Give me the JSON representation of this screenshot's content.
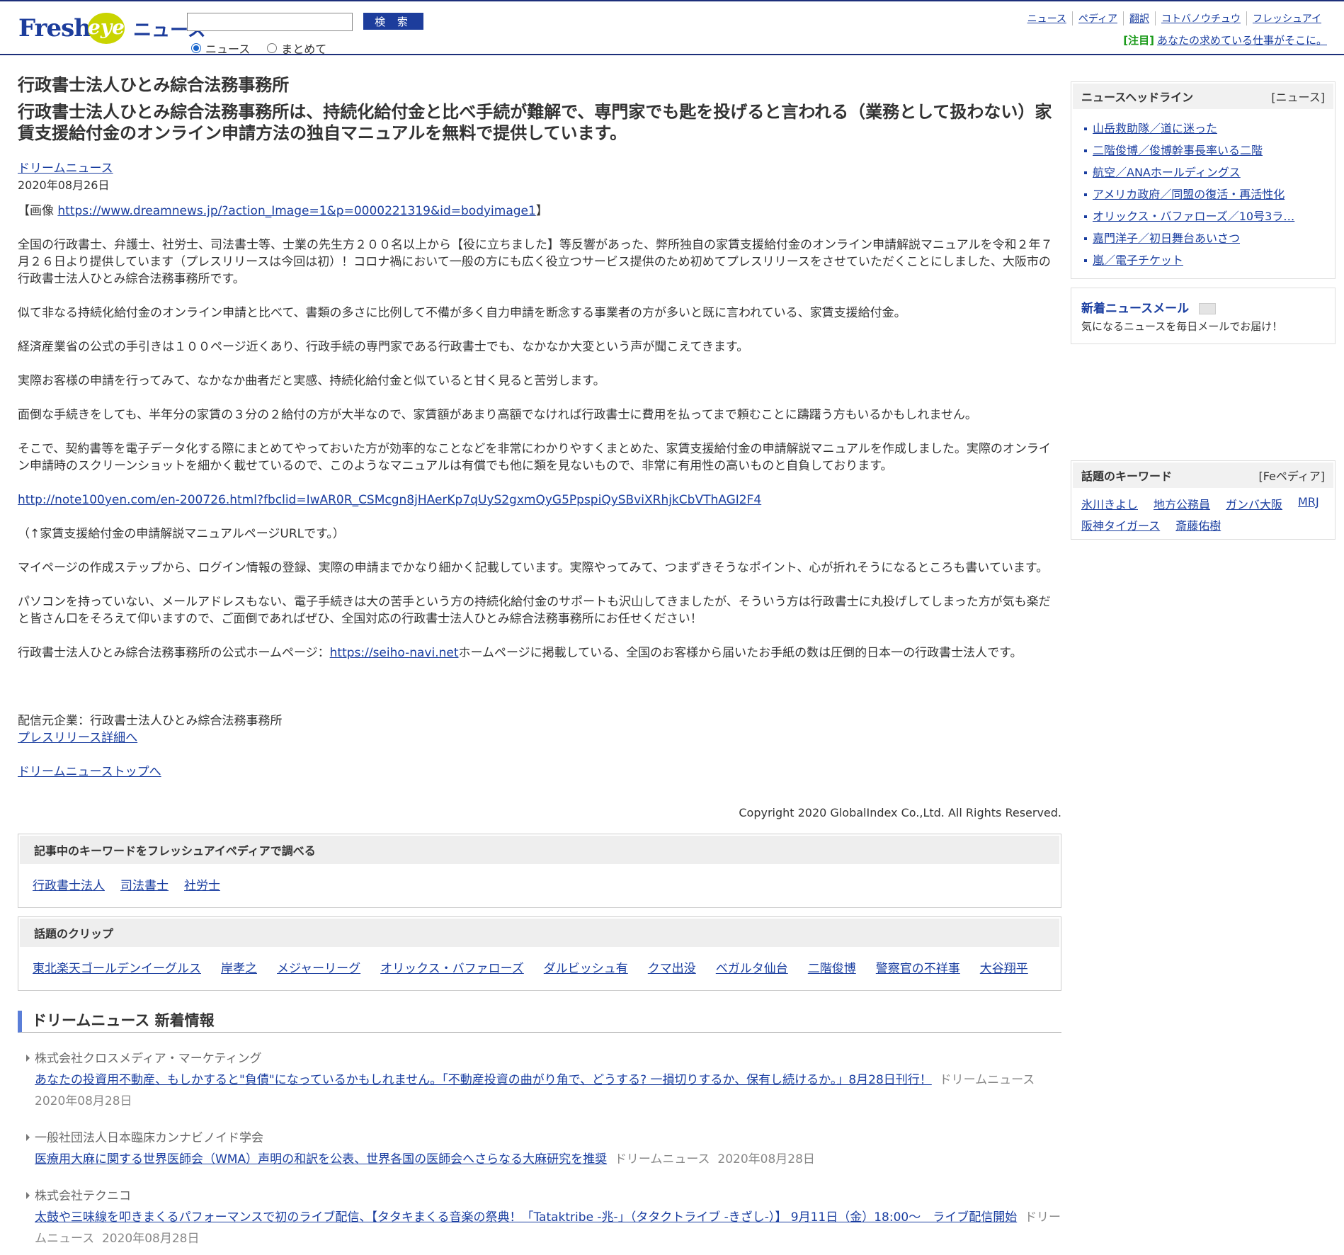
{
  "header": {
    "logo_fresh": "Fresh",
    "logo_eye": "eye",
    "logo_news": "ニュース",
    "search_button": "検 索",
    "radio_news": "ニュース",
    "radio_all": "まとめて",
    "toplinks": [
      "ニュース",
      "ペディア",
      "翻訳",
      "コトバノウチュウ",
      "フレッシュアイ"
    ],
    "notice_tag": "[注目]",
    "notice_link": "あなたの求めている仕事がそこに。"
  },
  "article": {
    "company_title": "行政書士法人ひとみ綜合法務事務所",
    "headline": "行政書士法人ひとみ綜合法務事務所は、持続化給付金と比べ手続が難解で、専門家でも匙を投げると言われる（業務として扱わない）家賃支援給付金のオンライン申請方法の独自マニュアルを無料で提供しています。",
    "source": "ドリームニュース",
    "date": "2020年08月26日",
    "image_prefix": "【画像 ",
    "image_url": "https://www.dreamnews.jp/?action_Image=1&p=0000221319&id=bodyimage1",
    "image_suffix": "】",
    "p1": "全国の行政書士、弁護士、社労士、司法書士等、士業の先生方２００名以上から【役に立ちました】等反響があった、弊所独自の家賃支援給付金のオンライン申請解説マニュアルを令和２年７月２６日より提供しています（プレスリリースは今回は初）！コロナ禍において一般の方にも広く役立つサービス提供のため初めてプレスリリースをさせていただくことにしました、大阪市の行政書士法人ひとみ綜合法務事務所です。",
    "p2": "似て非なる持続化給付金のオンライン申請と比べて、書類の多さに比例して不備が多く自力申請を断念する事業者の方が多いと既に言われている、家賃支援給付金。",
    "p3": "経済産業省の公式の手引きは１００ページ近くあり、行政手続の専門家である行政書士でも、なかなか大変という声が聞こえてきます。",
    "p4": "実際お客様の申請を行ってみて、なかなか曲者だと実感、持続化給付金と似ていると甘く見ると苦労します。",
    "p5": "面倒な手続きをしても、半年分の家賃の３分の２給付の方が大半なので、家賃額があまり高額でなければ行政書士に費用を払ってまで頼むことに躊躇う方もいるかもしれません。",
    "p6": "そこで、契約書等を電子データ化する際にまとめてやっておいた方が効率的なことなどを非常にわかりやすくまとめた、家賃支援給付金の申請解説マニュアルを作成しました。実際のオンライン申請時のスクリーンショットを細かく載せているので、このようなマニュアルは有償でも他に類を見ないもので、非常に有用性の高いものと自負しております。",
    "manual_url": "http://note100yen.com/en-200726.html?fbclid=IwAR0R_CSMcgn8jHAerKp7qUyS2gxmQyG5PpspiQySBviXRhjkCbVThAGI2F4",
    "p7": "（↑家賃支援給付金の申請解説マニュアルページURLです。）",
    "p8": "マイページの作成ステップから、ログイン情報の登録、実際の申請までかなり細かく記載しています。実際やってみて、つまずきそうなポイント、心が折れそうになるところも書いています。",
    "p9": "パソコンを持っていない、メールアドレスもない、電子手続きは大の苦手という方の持続化給付金のサポートも沢山してきましたが、そういう方は行政書士に丸投げしてしまった方が気も楽だと皆さん口をそろえて仰いますので、ご面倒であればぜひ、全国対応の行政書士法人ひとみ綜合法務事務所にお任せください！",
    "p10_prefix": "行政書士法人ひとみ綜合法務事務所の公式ホームページ：",
    "p10_url": "https://seiho-navi.net",
    "p10_suffix": "ホームページに掲載している、全国のお客様から届いたお手紙の数は圧倒的日本一の行政書士法人です。",
    "distributor": "配信元企業：行政書士法人ひとみ綜合法務事務所",
    "press_detail": "プレスリリース詳細へ",
    "dream_top": "ドリームニューストップへ",
    "copyright": "Copyright 2020 GlobalIndex Co.,Ltd. All Rights Reserved."
  },
  "keyword_box": {
    "title": "記事中のキーワードをフレッシュアイペディアで調べる",
    "items": [
      "行政書士法人",
      "司法書士",
      "社労士"
    ]
  },
  "clip_box": {
    "title": "話題のクリップ",
    "items": [
      "東北楽天ゴールデンイーグルス",
      "岸孝之",
      "メジャーリーグ",
      "オリックス・バファローズ",
      "ダルビッシュ有",
      "クマ出没",
      "ベガルタ仙台",
      "二階俊博",
      "警察官の不祥事",
      "大谷翔平"
    ]
  },
  "dream_news": {
    "title": "ドリームニュース 新着情報",
    "items": [
      {
        "company": "株式会社クロスメディア・マーケティング",
        "link": "あなたの投資用不動産、もしかすると\"負債\"になっているかもしれません。「不動産投資の曲がり角で、どうする? 一損切りするか、保有し続けるか。」8月28日刊行！",
        "source": "ドリームニュース",
        "date": "2020年08月28日"
      },
      {
        "company": "一般社団法人日本臨床カンナビノイド学会",
        "link": "医療用大麻に関する世界医師会（WMA）声明の和訳を公表、世界各国の医師会へさらなる大麻研究を推奨",
        "source": "ドリームニュース",
        "date": "2020年08月28日"
      },
      {
        "company": "株式会社テクニコ",
        "link": "太鼓や三味線を叩きまくるパフォーマンスで初のライブ配信、【タタキまくる音楽の祭典！「Tataktribe -兆-」（タタクトライブ -きざし-）】 9月11日（金）18:00～　ライブ配信開始",
        "source": "ドリームニュース",
        "date": "2020年08月28日"
      }
    ]
  },
  "sidebar": {
    "headline_title": "ニュースヘッドライン",
    "headline_tag": "[ニュース]",
    "headlines": [
      "山岳救助隊／道に迷った",
      "二階俊博／俊博幹事長率いる二階",
      "航空／ANAホールディングス",
      "アメリカ政府／同盟の復活・再活性化",
      "オリックス・バファローズ／10号3ラ…",
      "嘉門洋子／初日舞台あいさつ",
      "嵐／電子チケット"
    ],
    "mail_title": "新着ニュースメール",
    "mail_desc": "気になるニュースを毎日メールでお届け！",
    "keyword_title": "話題のキーワード",
    "keyword_tag": "[Feペディア]",
    "keywords": [
      "氷川きよし",
      "地方公務員",
      "ガンバ大阪",
      "MRJ",
      "阪神タイガース",
      "斎藤佑樹"
    ]
  }
}
